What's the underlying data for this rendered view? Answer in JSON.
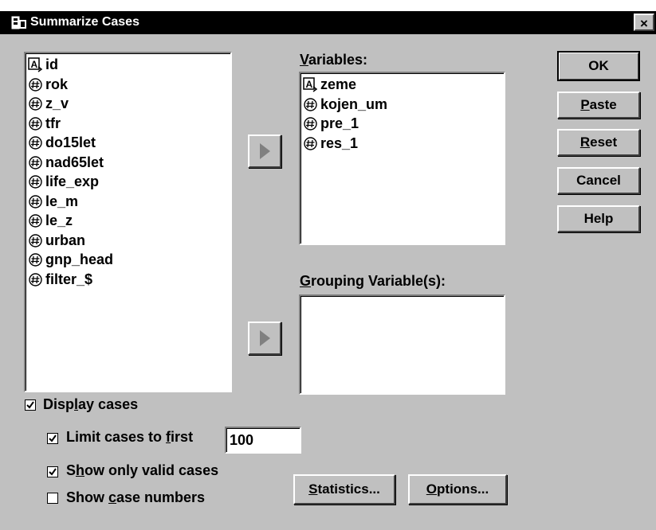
{
  "window": {
    "title": "Summarize Cases",
    "close_label": "×"
  },
  "source_list": {
    "items": [
      {
        "label": "id",
        "icon": "string-variable-icon"
      },
      {
        "label": "rok",
        "icon": "numeric-variable-icon"
      },
      {
        "label": "z_v",
        "icon": "numeric-variable-icon"
      },
      {
        "label": "tfr",
        "icon": "numeric-variable-icon"
      },
      {
        "label": "do15let",
        "icon": "numeric-variable-icon"
      },
      {
        "label": "nad65let",
        "icon": "numeric-variable-icon"
      },
      {
        "label": "life_exp",
        "icon": "numeric-variable-icon"
      },
      {
        "label": "le_m",
        "icon": "numeric-variable-icon"
      },
      {
        "label": "le_z",
        "icon": "numeric-variable-icon"
      },
      {
        "label": "urban",
        "icon": "numeric-variable-icon"
      },
      {
        "label": "gnp_head",
        "icon": "numeric-variable-icon"
      },
      {
        "label": "filter_$",
        "icon": "numeric-variable-icon"
      }
    ]
  },
  "variables": {
    "label_pre": "",
    "label_key": "V",
    "label_post": "ariables:",
    "items": [
      {
        "label": "zeme",
        "icon": "string-variable-icon"
      },
      {
        "label": "kojen_um",
        "icon": "numeric-variable-icon"
      },
      {
        "label": "pre_1",
        "icon": "numeric-variable-icon"
      },
      {
        "label": "res_1",
        "icon": "numeric-variable-icon"
      }
    ]
  },
  "grouping": {
    "label_pre": "",
    "label_key": "G",
    "label_post": "rouping Variable(s):",
    "items": []
  },
  "buttons": {
    "ok": {
      "pre": "OK",
      "key": "",
      "post": ""
    },
    "paste": {
      "pre": "",
      "key": "P",
      "post": "aste"
    },
    "reset": {
      "pre": "",
      "key": "R",
      "post": "eset"
    },
    "cancel": {
      "pre": "Cancel",
      "key": "",
      "post": ""
    },
    "help": {
      "pre": "Help",
      "key": "",
      "post": ""
    },
    "statistics": {
      "pre": "",
      "key": "S",
      "post": "tatistics..."
    },
    "options": {
      "pre": "",
      "key": "O",
      "post": "ptions..."
    }
  },
  "options": {
    "display_cases": {
      "pre": "Disp",
      "key": "l",
      "post": "ay cases",
      "checked": true
    },
    "limit_cases": {
      "pre": "Limit cases to ",
      "key": "f",
      "post": "irst",
      "checked": true,
      "value": "100"
    },
    "valid_only": {
      "pre": "S",
      "key": "h",
      "post": "ow only valid cases",
      "checked": true
    },
    "case_numbers": {
      "pre": "Show ",
      "key": "c",
      "post": "ase numbers",
      "checked": false
    }
  }
}
